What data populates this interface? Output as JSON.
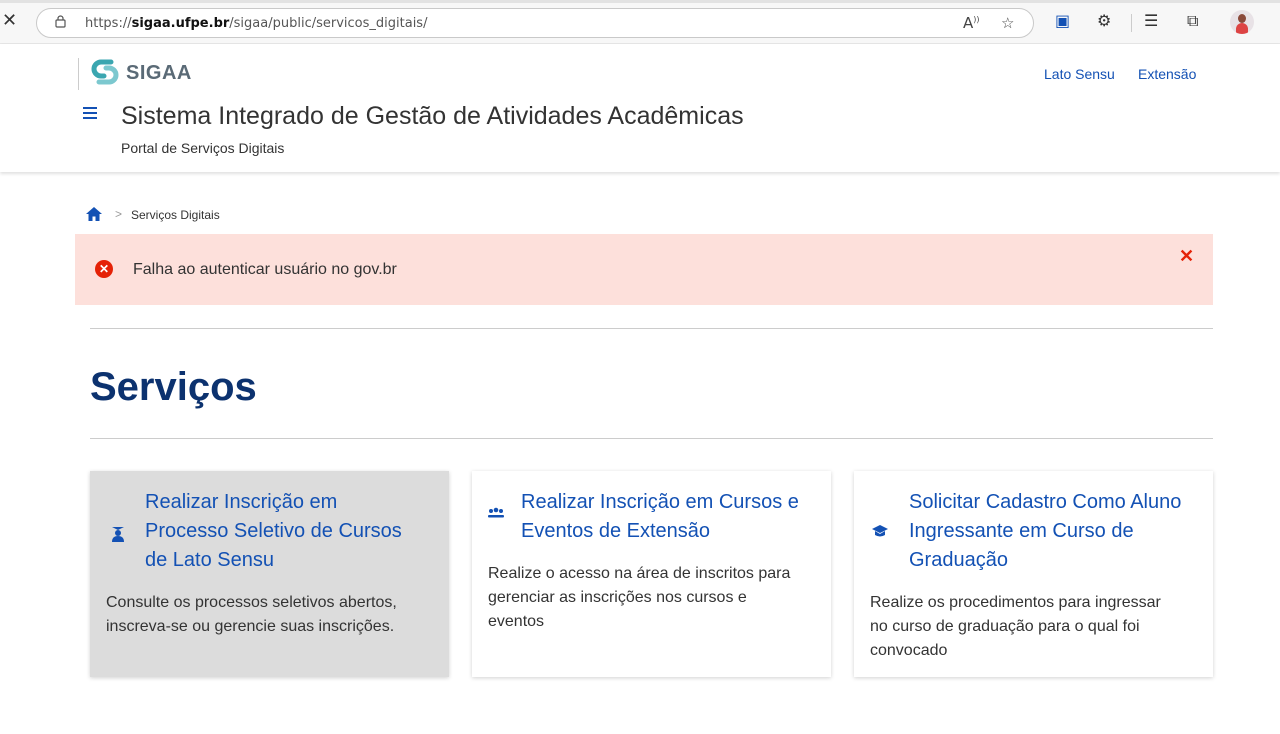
{
  "browser": {
    "url_prefix": "https://",
    "url_domain": "sigaa.ufpe.br",
    "url_path": "/sigaa/public/servicos_digitais/"
  },
  "header": {
    "logo_text": "SIGAA",
    "links": [
      "Lato Sensu",
      "Extensão"
    ],
    "title": "Sistema Integrado de Gestão de Atividades Acadêmicas",
    "subtitle": "Portal de Serviços Digitais"
  },
  "breadcrumb": {
    "current": "Serviços Digitais"
  },
  "alert": {
    "message": "Falha ao autenticar usuário no gov.br",
    "color": "#e52207",
    "background": "#fde0db"
  },
  "main": {
    "title": "Serviços",
    "cards": [
      {
        "icon": "user-graduate-icon",
        "title_lines": [
          "Realizar Inscrição em",
          "Processo Seletivo de Cursos",
          "de Lato Sensu"
        ],
        "desc_lines": [
          "Consulte os processos seletivos abertos,",
          "inscreva-se ou gerencie suas inscrições."
        ]
      },
      {
        "icon": "users-icon",
        "title_lines": [
          "Realizar Inscrição em Cursos e",
          "Eventos de Extensão"
        ],
        "desc_lines": [
          "Realize o acesso na área de inscritos para",
          "gerenciar as inscrições nos cursos e",
          "eventos"
        ]
      },
      {
        "icon": "graduation-cap-icon",
        "title_lines": [
          "Solicitar Cadastro Como Aluno",
          "Ingressante em Curso de",
          "Graduação"
        ],
        "desc_lines": [
          "Realize os procedimentos para ingressar",
          "no curso de graduação para o qual foi",
          "convocado"
        ]
      }
    ]
  },
  "colors": {
    "primary": "#1351b4",
    "title_dark": "#0c326f"
  }
}
